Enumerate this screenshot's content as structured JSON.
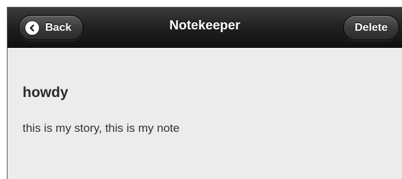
{
  "header": {
    "title": "Notekeeper",
    "back_label": "Back",
    "delete_label": "Delete"
  },
  "note": {
    "title": "howdy",
    "body": "this is my story, this is my note"
  },
  "icons": {
    "back": "chevron-left-icon"
  },
  "colors": {
    "header_bg": "#1e1e1e",
    "content_bg": "#ececec",
    "title_text": "#ffffff",
    "note_text": "#333333"
  }
}
